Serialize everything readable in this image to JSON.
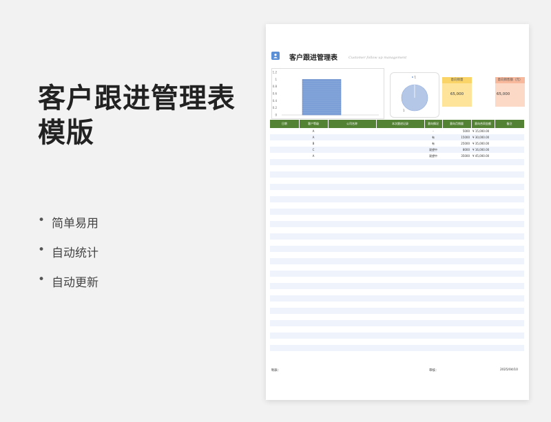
{
  "hero": {
    "title": "客户跟进管理表模版",
    "features": [
      "简单易用",
      "自动统计",
      "自动更新"
    ]
  },
  "sheet": {
    "title": "客户跟进管理表",
    "subtitle": "Customer follow up management",
    "kpis": [
      {
        "label": "意向销量",
        "value": "65,000",
        "color": "#fde49a"
      },
      {
        "label": "意向销售额（元）",
        "value": "65,000",
        "color": "#fcd9c6"
      }
    ],
    "table": {
      "headers": [
        "日期",
        "客户等级",
        "公司名称",
        "本次跟进记录",
        "意向情况",
        "意向月销量",
        "意向合同金额",
        "备注"
      ],
      "rows": [
        [
          "",
          "A",
          "",
          "",
          "-",
          "5000",
          "¥  15,000.00",
          ""
        ],
        [
          "",
          "A",
          "",
          "",
          "有",
          "15000",
          "¥  30,000.00",
          ""
        ],
        [
          "",
          "B",
          "",
          "",
          "有",
          "25000",
          "¥  35,000.00",
          ""
        ],
        [
          "",
          "C",
          "",
          "",
          "观望中",
          "8000",
          "¥  16,000.00",
          ""
        ],
        [
          "",
          "A",
          "",
          "",
          "观望中",
          "35000",
          "¥  45,000.00",
          ""
        ]
      ]
    },
    "footer": {
      "maker": "制表：",
      "reviewer": "审核：",
      "date": "2025/04/10"
    }
  },
  "chart_data": [
    {
      "type": "bar",
      "categories": [
        ""
      ],
      "values": [
        1
      ],
      "ylim": [
        0,
        1.2
      ],
      "yticks": [
        "1.2",
        "1",
        "0.8",
        "0.6",
        "0.4",
        "0.2",
        "0"
      ],
      "color": "#7b9fd6"
    },
    {
      "type": "pie",
      "labels": [
        "1"
      ],
      "values": [
        1
      ],
      "color": "#b4c7e7"
    }
  ],
  "colors": {
    "header_green": "#548235",
    "stripe": "#eff3fb",
    "accent_blue": "#5b8fd6"
  }
}
